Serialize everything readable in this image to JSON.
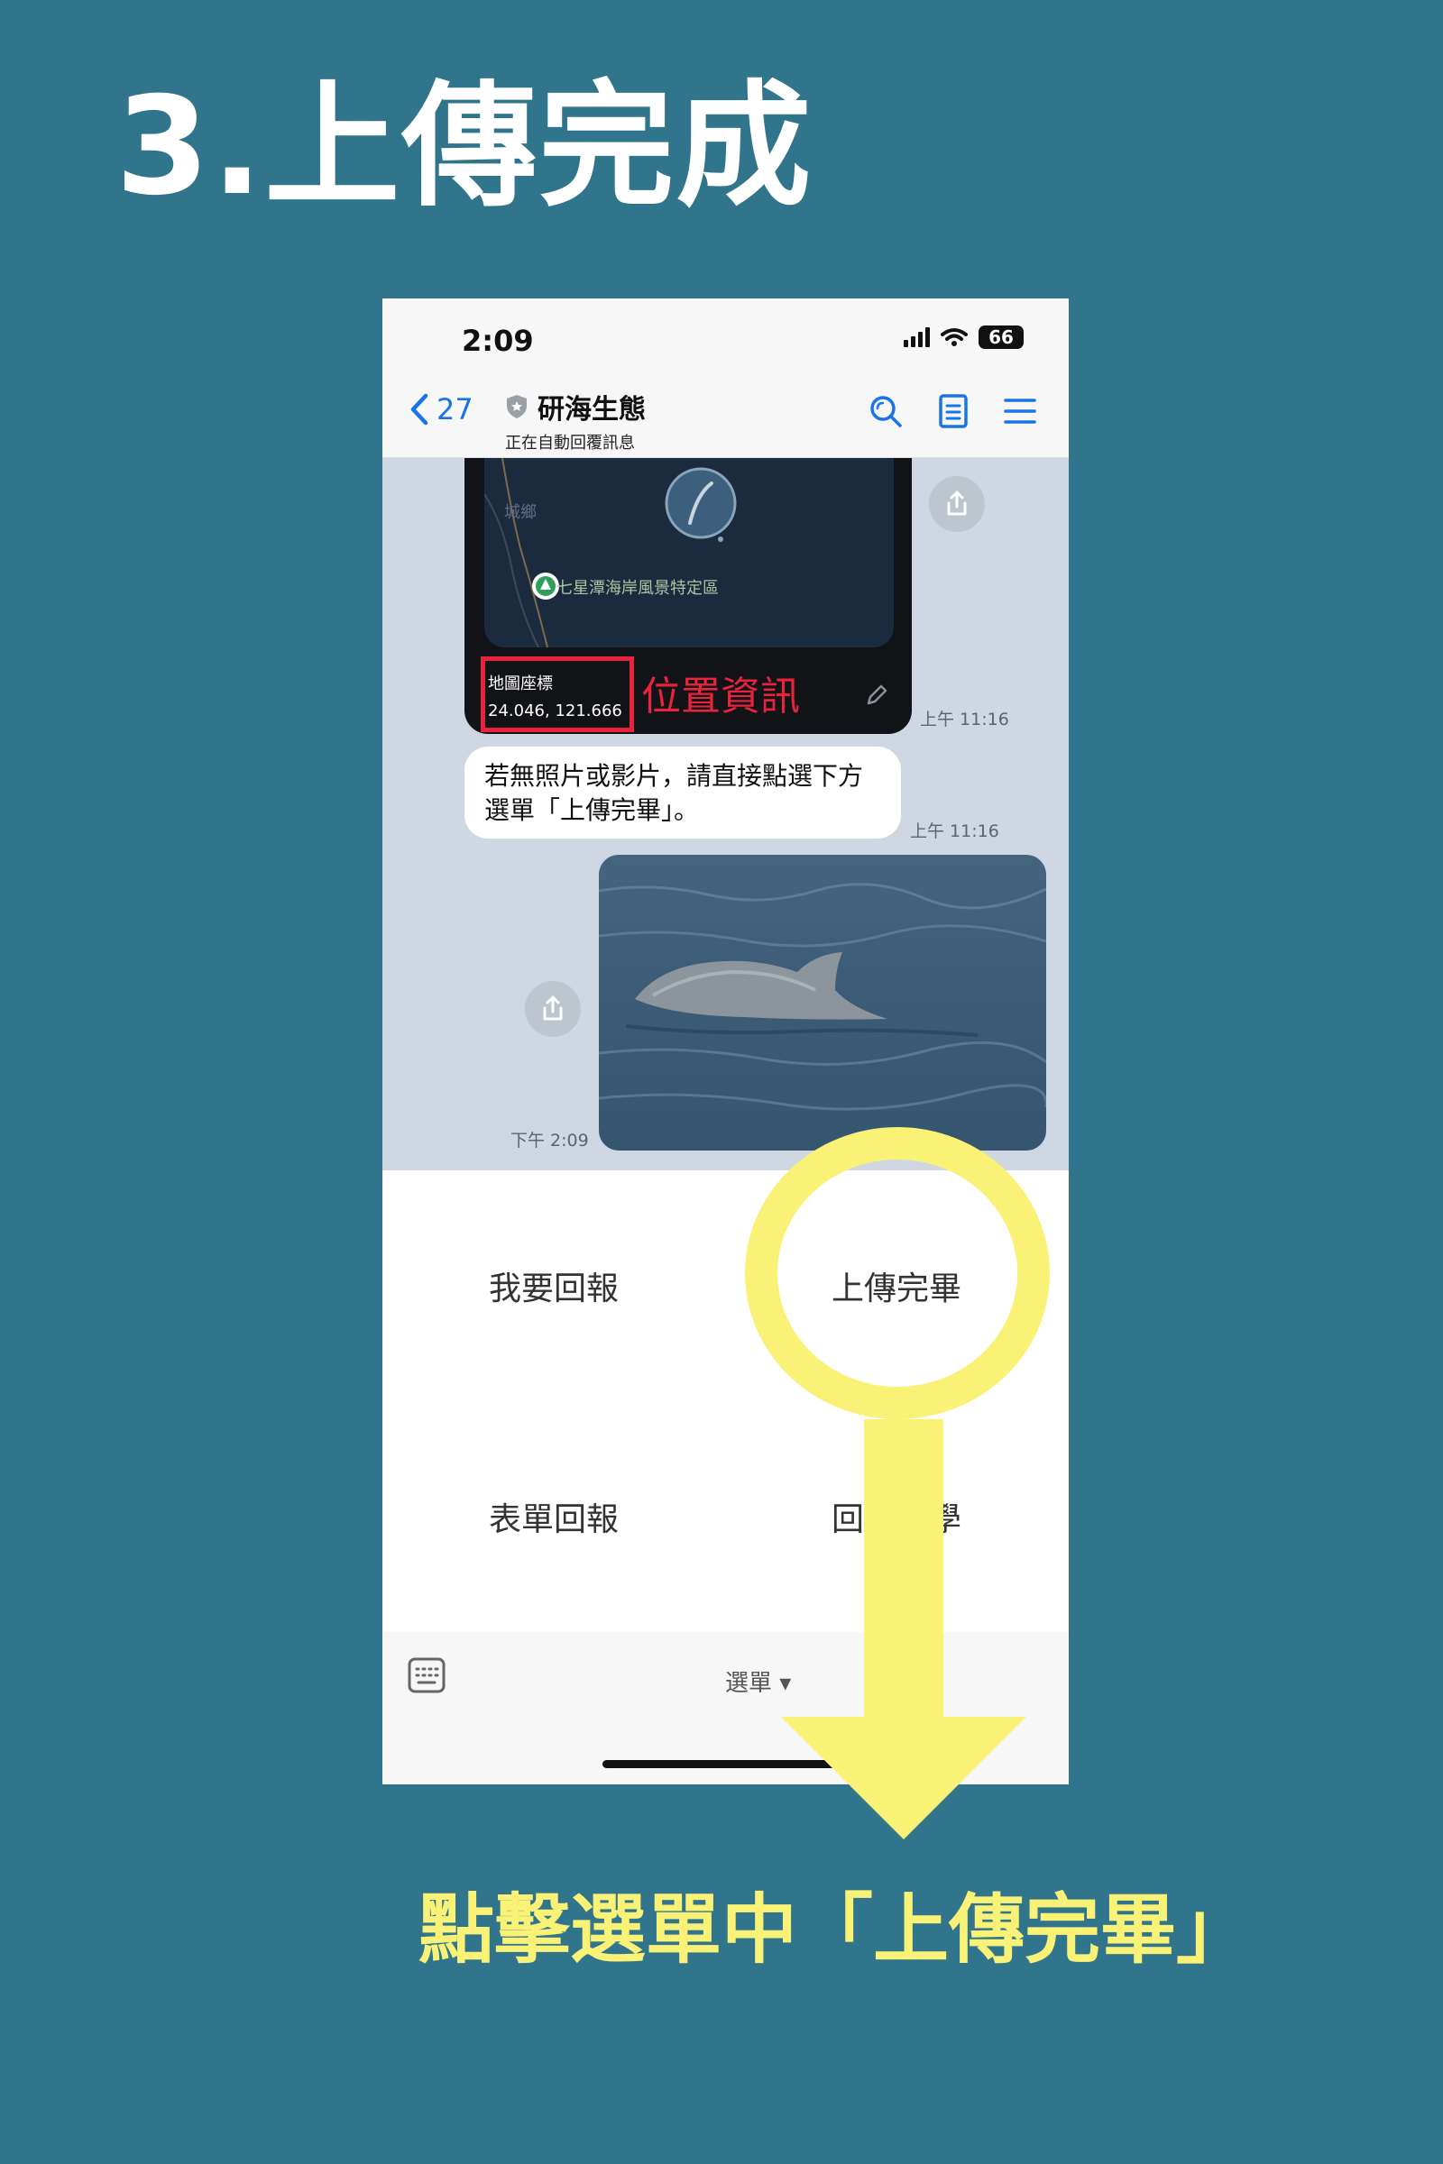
{
  "page": {
    "title": "3.上傳完成",
    "caption": "點擊選單中「上傳完畢」"
  },
  "status_bar": {
    "time": "2:09",
    "battery": "66"
  },
  "nav": {
    "back_count": "27",
    "chat_name": "研海生態",
    "chat_subtitle": "正在自動回覆訊息"
  },
  "messages": {
    "map": {
      "town_label": "城鄉",
      "place_label": "七星潭海岸風景特定區",
      "coord_label": "地圖座標",
      "coord_value": "24.046, 121.666",
      "annotation": "位置資訊",
      "time": "上午 11:16"
    },
    "text": {
      "body": "若無照片或影片，請直接點選下方選單「上傳完畢」。",
      "time": "上午 11:16"
    },
    "photo": {
      "time": "下午 2:09"
    }
  },
  "menu": {
    "items": [
      {
        "label": "我要回報"
      },
      {
        "label": "上傳完畢"
      },
      {
        "label": "表單回報"
      },
      {
        "label": "回報教學"
      }
    ],
    "toggle_label": "選單 ▾"
  },
  "colors": {
    "background": "#30758b",
    "highlight": "#f9f277",
    "annotation_red": "#e8233b",
    "link_blue": "#1a73e8"
  }
}
